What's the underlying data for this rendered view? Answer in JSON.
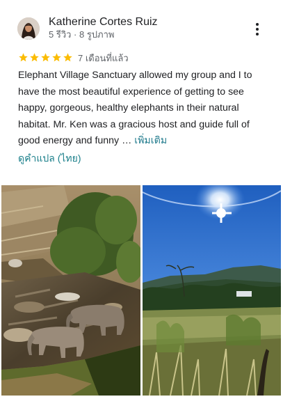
{
  "review": {
    "author_name": "Katherine Cortes Ruiz",
    "author_meta": "5 รีวิว · 8 รูปภาพ",
    "rating": 5,
    "age": "7 เดือนที่แล้ว",
    "text": "Elephant Village Sanctuary allowed my group and I to have the most beautiful experience of getting to see happy, gorgeous, healthy elephants in their natural habitat. Mr. Ken was a gracious host and guide full of good energy and funny …",
    "read_more_label": "เพิ่มเติม",
    "translate_label": "ดูคำแปล (ไทย)"
  },
  "icons": {
    "star": "star-icon",
    "more": "more-vert-icon"
  },
  "colors": {
    "star": "#fbbc04",
    "link": "#1a7f8a",
    "secondary_text": "#5f6368"
  },
  "photos": [
    {
      "subject": "elephants-in-river"
    },
    {
      "subject": "sunny-forest-valley"
    }
  ]
}
